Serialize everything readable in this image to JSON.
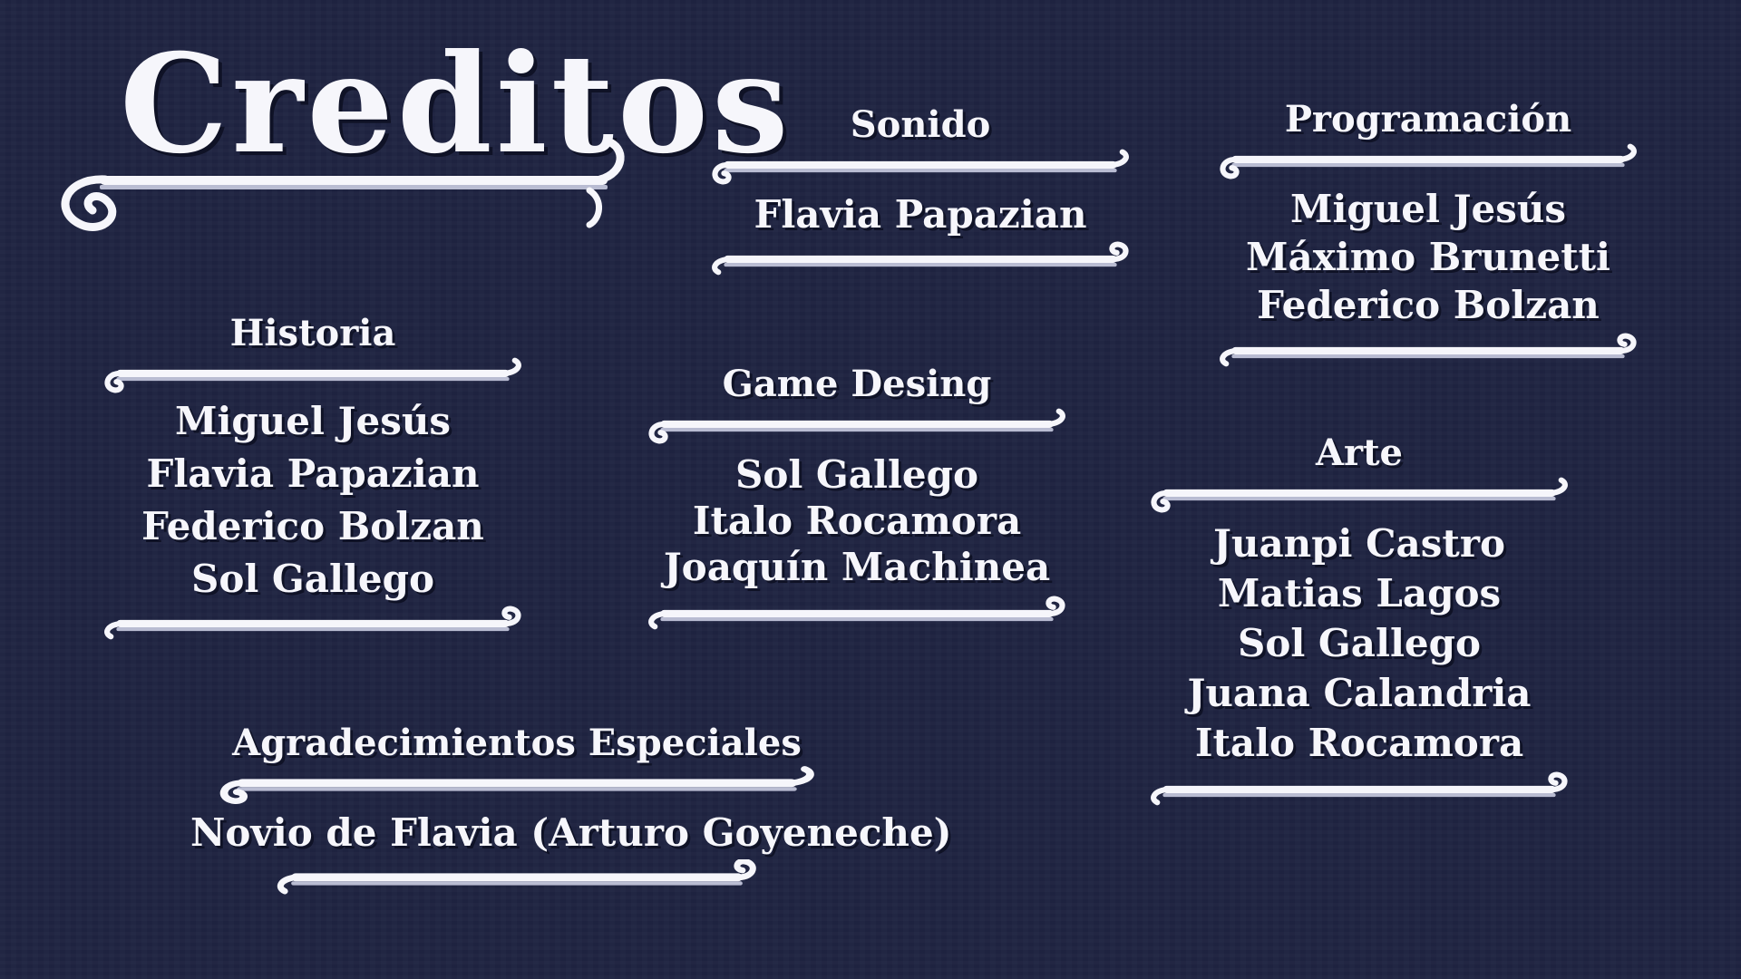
{
  "title": "Creditos",
  "colors": {
    "background": "#1f2442",
    "text": "#f6f6fb",
    "shadow": "#0f1226"
  },
  "sections": {
    "sonido": {
      "heading": "Sonido",
      "names": [
        "Flavia Papazian"
      ]
    },
    "programacion": {
      "heading": "Programación",
      "names": [
        "Miguel Jesús",
        "Máximo Brunetti",
        "Federico Bolzan"
      ]
    },
    "historia": {
      "heading": "Historia",
      "names": [
        "Miguel Jesús",
        "Flavia Papazian",
        "Federico Bolzan",
        "Sol Gallego"
      ]
    },
    "game_desing": {
      "heading": "Game Desing",
      "names": [
        "Sol Gallego",
        "Italo Rocamora",
        "Joaquín Machinea"
      ]
    },
    "arte": {
      "heading": "Arte",
      "names": [
        "Juanpi Castro",
        "Matias Lagos",
        "Sol Gallego",
        "Juana Calandria",
        "Italo Rocamora"
      ]
    },
    "agradecimientos": {
      "heading": "Agradecimientos Especiales",
      "names": [
        "Novio de Flavia (Arturo Goyeneche)"
      ]
    }
  }
}
